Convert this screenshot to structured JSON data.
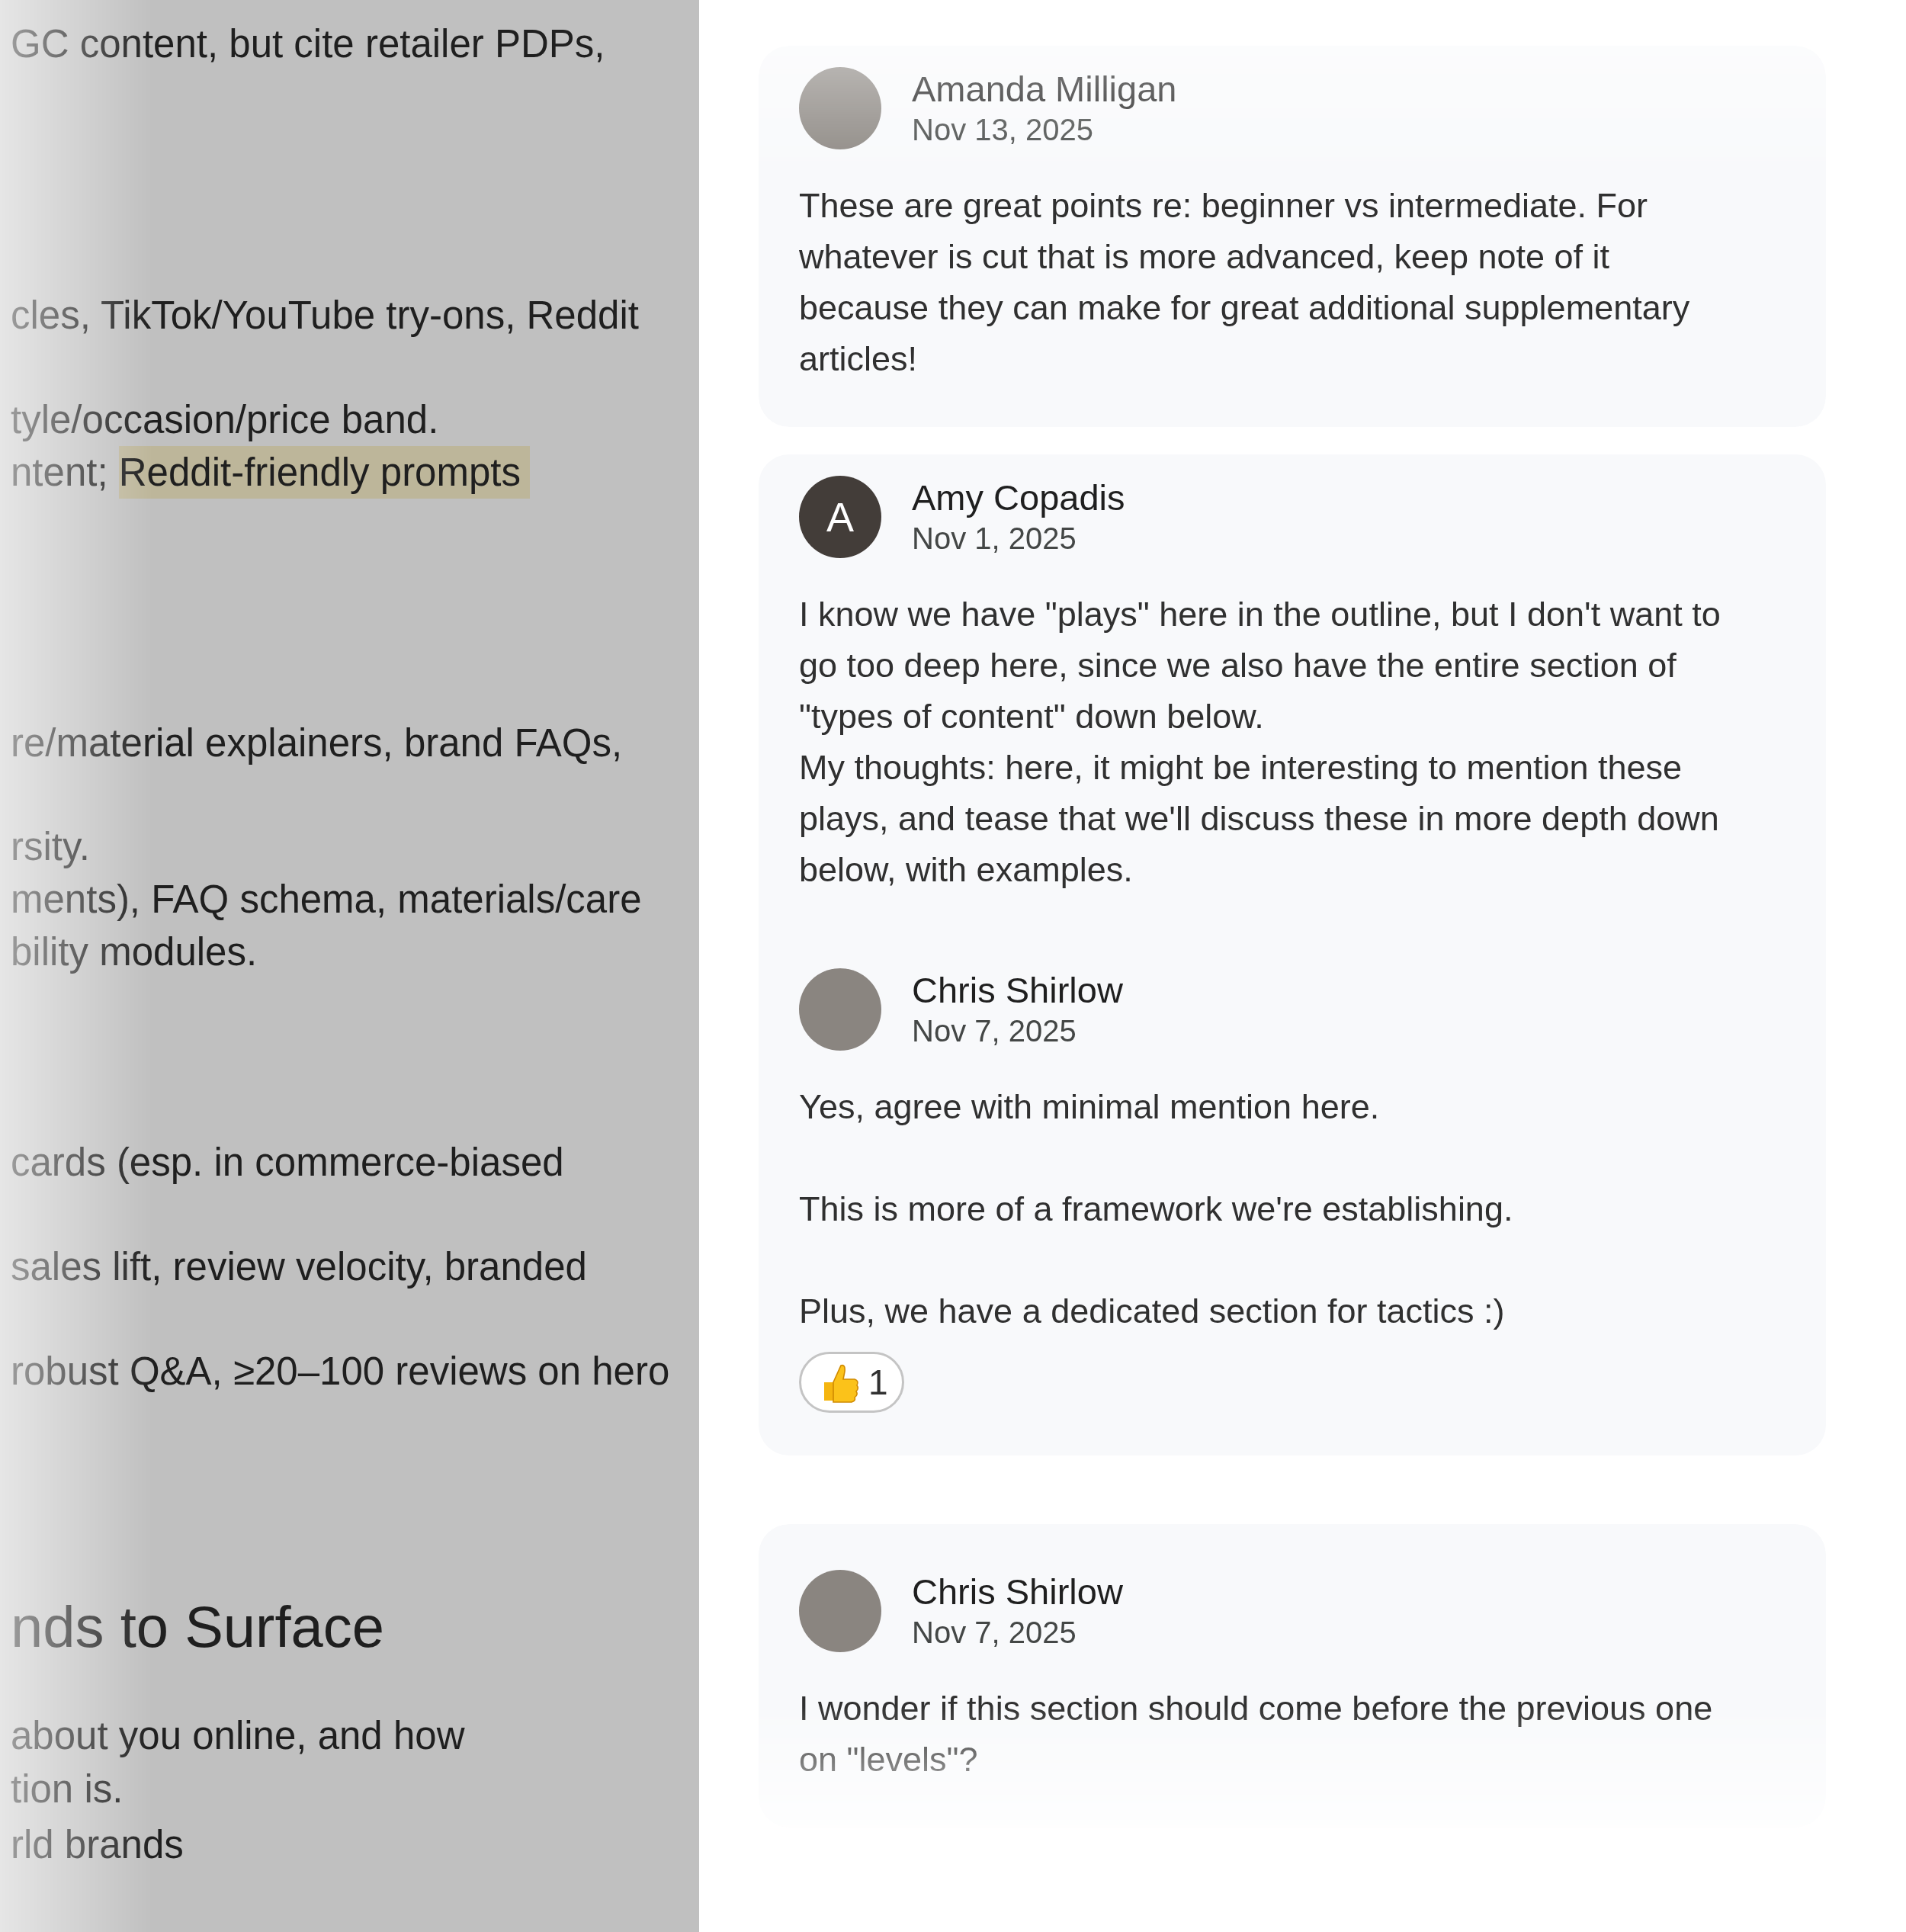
{
  "document_panel": {
    "lines": [
      {
        "kind": "text",
        "segments": [
          {
            "text": "GC content, but cite retailer PDPs,",
            "highlighted": false
          }
        ]
      },
      {
        "kind": "text",
        "segments": [
          {
            "text": "cles, TikTok/YouTube try-ons, Reddit",
            "highlighted": false
          }
        ]
      },
      {
        "kind": "text",
        "segments": [
          {
            "text": "tyle/occasion/price band.",
            "highlighted": false
          }
        ]
      },
      {
        "kind": "text",
        "segments": [
          {
            "text": "ntent; ",
            "highlighted": false
          },
          {
            "text": "Reddit-friendly prompts",
            "highlighted": true
          }
        ]
      },
      {
        "kind": "text",
        "segments": [
          {
            "text": "re/material explainers, brand FAQs,",
            "highlighted": false
          }
        ]
      },
      {
        "kind": "text",
        "segments": [
          {
            "text": "rsity.",
            "highlighted": false
          }
        ]
      },
      {
        "kind": "text",
        "segments": [
          {
            "text": "ments), FAQ schema, materials/care",
            "highlighted": false
          }
        ]
      },
      {
        "kind": "text",
        "segments": [
          {
            "text": "bility modules.",
            "highlighted": false
          }
        ]
      },
      {
        "kind": "text",
        "segments": [
          {
            "text": "cards (esp. in commerce-biased",
            "highlighted": false
          }
        ]
      },
      {
        "kind": "text",
        "segments": [
          {
            "text": "sales lift, review velocity, branded",
            "highlighted": false
          }
        ]
      },
      {
        "kind": "text",
        "segments": [
          {
            "text": "robust Q&A, ≥20–100 reviews on hero",
            "highlighted": false
          }
        ]
      },
      {
        "kind": "heading",
        "segments": [
          {
            "text": "nds to Surface",
            "highlighted": false
          }
        ]
      },
      {
        "kind": "text",
        "segments": [
          {
            "text": "about you online, and how",
            "highlighted": false
          }
        ]
      },
      {
        "kind": "text",
        "segments": [
          {
            "text": "tion is.",
            "highlighted": false
          }
        ]
      },
      {
        "kind": "text",
        "segments": [
          {
            "text": "rld brands",
            "highlighted": false
          }
        ]
      }
    ]
  },
  "comment_threads": [
    {
      "comments": [
        {
          "author": "Amanda Milligan",
          "date": "Nov 13, 2025",
          "avatar": {
            "kind": "photo"
          },
          "paragraphs": [
            "These are great points re: beginner vs intermediate. For whatever is cut that is more advanced, keep note of it because they can make for great additional supplementary articles!"
          ]
        }
      ]
    },
    {
      "comments": [
        {
          "author": "Amy Copadis",
          "date": "Nov 1, 2025",
          "avatar": {
            "kind": "letter",
            "letter": "A"
          },
          "paragraphs": [
            "I know we have \"plays\" here in the outline, but I don't want to go too deep here, since we also have the entire section of \"types of content\" down below.",
            "My thoughts: here, it might be interesting to mention these plays, and tease that we'll discuss these in more depth down below, with examples."
          ]
        },
        {
          "kind": "spaced",
          "author": "Chris Shirlow",
          "date": "Nov 7, 2025",
          "avatar": {
            "kind": "photo"
          },
          "paragraphs": [
            "Yes, agree with minimal mention here.",
            "This is more of a framework we're establishing.",
            "Plus, we have a dedicated section for tactics :)"
          ],
          "reactions": [
            {
              "count": "1"
            }
          ]
        }
      ]
    },
    {
      "comments": [
        {
          "author": "Chris Shirlow",
          "date": "Nov 7, 2025",
          "avatar": {
            "kind": "photo"
          },
          "paragraphs": [
            "I wonder if this section should come before the previous one on \"levels\"?"
          ]
        }
      ]
    }
  ]
}
